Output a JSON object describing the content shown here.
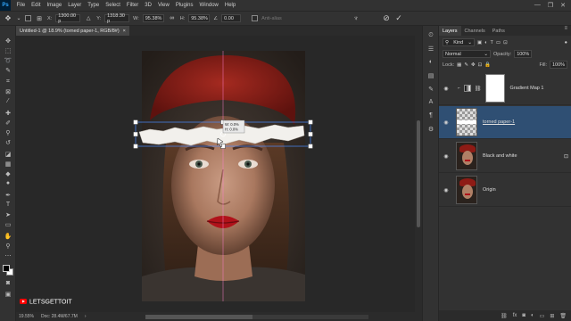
{
  "app": {
    "logo": "Ps"
  },
  "menu": [
    "File",
    "Edit",
    "Image",
    "Layer",
    "Type",
    "Select",
    "Filter",
    "3D",
    "View",
    "Plugins",
    "Window",
    "Help"
  ],
  "window_buttons": [
    "—",
    "❐",
    "✕"
  ],
  "options": {
    "x_label": "X:",
    "x_value": "1300.00 p",
    "y_label": "Y:",
    "y_value": "1318.30 p",
    "w_label": "W:",
    "w_value": "95.38%",
    "h_label": "H:",
    "h_value": "95.38%",
    "angle_label": "∠",
    "angle_value": "0.00",
    "antialias_label": "Anti-alias"
  },
  "document": {
    "tab_title": "Untitled-1 @ 18.9% (torned paper-1, RGB/8#)",
    "tab_close": "×"
  },
  "transform_tooltip": {
    "line1": "W: 0.0%",
    "line2": "H: 0.0%"
  },
  "status": {
    "zoom": "19.55%",
    "doc": "Doc: 28.4M/67.7M"
  },
  "watermark": {
    "text": "LETSGETTOIT"
  },
  "layers_panel": {
    "tabs": [
      "Layers",
      "Channels",
      "Paths"
    ],
    "filter_label": "Kind",
    "blend_mode": "Normal",
    "opacity_label": "Opacity:",
    "opacity_value": "100%",
    "lock_label": "Lock:",
    "fill_label": "Fill:",
    "fill_value": "100%",
    "layers": [
      {
        "name": "Gradient Map 1",
        "visible": true,
        "selected": false,
        "type": "adjustment"
      },
      {
        "name": "torned paper-1",
        "visible": true,
        "selected": true,
        "type": "transparent"
      },
      {
        "name": "Black and white",
        "visible": true,
        "selected": false,
        "type": "photo"
      },
      {
        "name": "Origin",
        "visible": true,
        "selected": false,
        "type": "photo"
      }
    ]
  },
  "colors": {
    "accent": "#2f4f73",
    "panel_bg": "#323232",
    "canvas_bg": "#282828",
    "lips": "#b0121a",
    "beret": "#8e1b15"
  }
}
